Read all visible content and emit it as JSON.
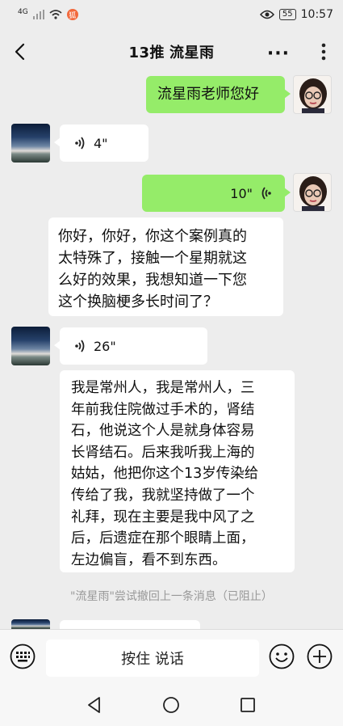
{
  "status_bar": {
    "network": "4G",
    "notification": "狐",
    "battery": "55",
    "time": "10:57"
  },
  "header": {
    "title_left": "13推",
    "title_right": "流星雨",
    "more": "···"
  },
  "messages": [
    {
      "side": "right",
      "type": "text",
      "text": "流星雨老师您好"
    },
    {
      "side": "left",
      "type": "voice",
      "duration": "4\""
    },
    {
      "side": "right",
      "type": "voice",
      "duration": "10\""
    },
    {
      "side": "left",
      "type": "text",
      "lines": [
        "你好，你好，你这个案例真的",
        "太特殊了，接触一个星期就这",
        "么好的效果，我想知道一下您",
        "这个换脑梗多长时间了？"
      ]
    },
    {
      "side": "left",
      "type": "voice",
      "duration": "26\""
    },
    {
      "side": "left",
      "type": "text",
      "lines": [
        "我是常州人，我是常州人，三",
        "年前我住院做过手术的，肾结",
        "石，他说这个人是就身体容易",
        "长肾结石。后来我听我上海的",
        "姑姑，他把你这个13岁传染给",
        "传给了我，我就坚持做了一个",
        "礼拜，现在主要是我中风了之",
        "后，后遗症在那个眼睛上面，",
        "左边偏盲，看不到东西。"
      ]
    }
  ],
  "system_note": "\"流星雨\"尝试撤回上一条消息（已阻止）",
  "input": {
    "hold_to_talk": "按住 说话"
  },
  "colors": {
    "green_bubble": "#95ec69",
    "chat_bg": "#ededed"
  }
}
